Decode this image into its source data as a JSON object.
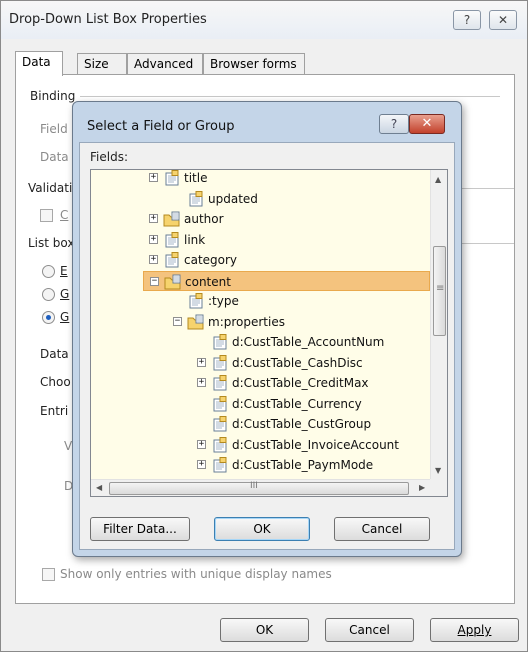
{
  "outer_dialog": {
    "title": "Drop-Down List Box Properties",
    "help_glyph": "?",
    "close_glyph": "✕",
    "tabs": [
      {
        "label": "Data"
      },
      {
        "label": "Size"
      },
      {
        "label": "Advanced"
      },
      {
        "label": "Browser forms"
      }
    ],
    "labels": {
      "binding": "Binding",
      "field": "Field",
      "data": "Data",
      "validation": "Validati",
      "c_checkbox": "C",
      "list_box": "List box",
      "radio_e": "E",
      "radio_g1": "G",
      "radio_g2": "G",
      "data2": "Data",
      "choose": "Choo",
      "entries": "Entri",
      "v": "V",
      "d": "D"
    },
    "unique_names_label": "Show only entries with unique display names",
    "buttons": {
      "ok": "OK",
      "cancel": "Cancel",
      "apply": "Apply"
    }
  },
  "field_dialog": {
    "title": "Select a Field or Group",
    "help_glyph": "?",
    "close_glyph": "✕",
    "fields_label": "Fields:",
    "tree": [
      {
        "label": "title",
        "expander": "+",
        "icon": "field-icon"
      },
      {
        "label": "updated",
        "expander": "",
        "icon": "field-icon"
      },
      {
        "label": "author",
        "expander": "+",
        "icon": "folder-icon"
      },
      {
        "label": "link",
        "expander": "+",
        "icon": "field-icon"
      },
      {
        "label": "category",
        "expander": "+",
        "icon": "field-icon"
      },
      {
        "label": "content",
        "expander": "−",
        "icon": "folder-icon",
        "selected": true
      },
      {
        "label": ":type",
        "expander": "",
        "icon": "field-icon"
      },
      {
        "label": "m:properties",
        "expander": "−",
        "icon": "folder-icon"
      },
      {
        "label": "d:CustTable_AccountNum",
        "expander": "",
        "icon": "field-icon"
      },
      {
        "label": "d:CustTable_CashDisc",
        "expander": "+",
        "icon": "field-icon"
      },
      {
        "label": "d:CustTable_CreditMax",
        "expander": "+",
        "icon": "field-icon"
      },
      {
        "label": "d:CustTable_Currency",
        "expander": "",
        "icon": "field-icon"
      },
      {
        "label": "d:CustTable_CustGroup",
        "expander": "",
        "icon": "field-icon"
      },
      {
        "label": "d:CustTable_InvoiceAccount",
        "expander": "+",
        "icon": "field-icon"
      },
      {
        "label": "d:CustTable_PaymMode",
        "expander": "+",
        "icon": "field-icon"
      }
    ],
    "scroll": {
      "hscroll_dots": "III",
      "vscroll_grip": "≡"
    },
    "buttons": {
      "filter": "Filter Data...",
      "ok": "OK",
      "cancel": "Cancel"
    }
  },
  "colors": {
    "selection": "#f4c37e",
    "tree_background": "#fffde8",
    "dialog_frame": "#c4d5e8",
    "close_red": "#c2412c"
  }
}
